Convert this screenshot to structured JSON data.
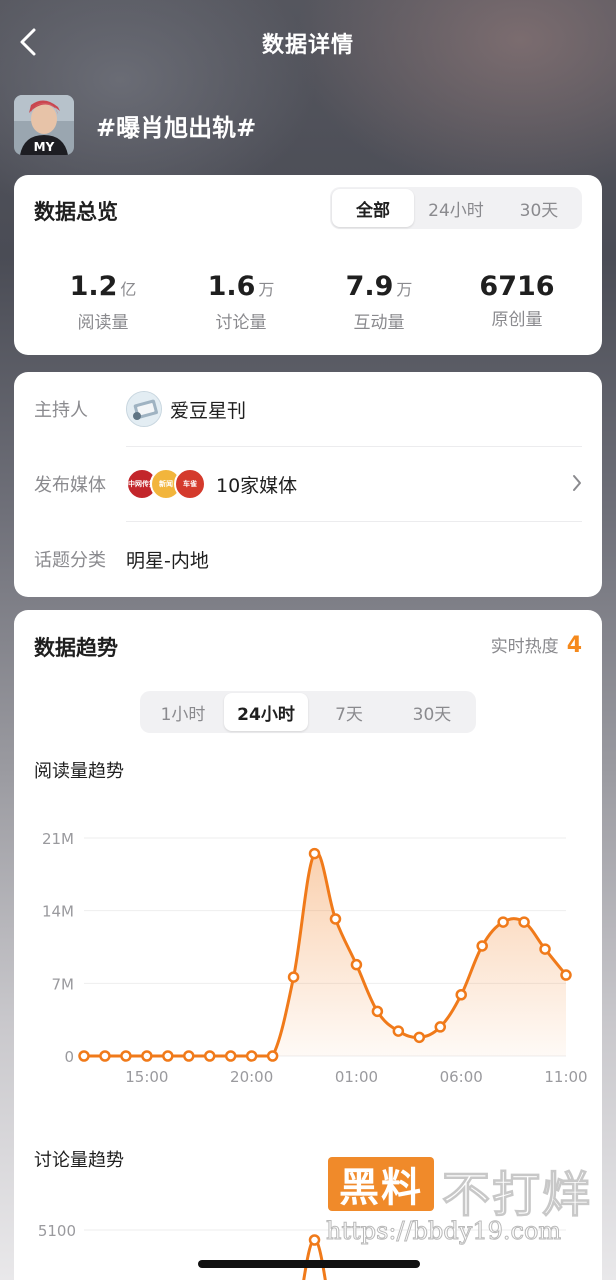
{
  "navbar": {
    "title": "数据详情"
  },
  "topic": {
    "title": "#曝肖旭出轨#",
    "avatar_text": "MY"
  },
  "overview": {
    "title": "数据总览",
    "tabs": [
      "全部",
      "24小时",
      "30天"
    ],
    "active_tab": "全部",
    "stats": [
      {
        "value": "1.2",
        "unit": "亿",
        "label": "阅读量"
      },
      {
        "value": "1.6",
        "unit": "万",
        "label": "讨论量"
      },
      {
        "value": "7.9",
        "unit": "万",
        "label": "互动量"
      },
      {
        "value": "6716",
        "unit": "",
        "label": "原创量"
      }
    ]
  },
  "info": {
    "host": {
      "label": "主持人",
      "value": "爱豆星刊"
    },
    "media": {
      "label": "发布媒体",
      "value": "10家媒体",
      "avatars": [
        "中网传播",
        "新闻",
        "车雀"
      ]
    },
    "category": {
      "label": "话题分类",
      "value": "明星-内地"
    }
  },
  "trend": {
    "title": "数据趋势",
    "heat_label": "实时热度",
    "heat_value": "4",
    "tabs": [
      "1小时",
      "24小时",
      "7天",
      "30天"
    ],
    "active_tab": "24小时",
    "read_chart_title": "阅读量趋势",
    "discuss_chart_title": "讨论量趋势"
  },
  "chart_data": [
    {
      "type": "area",
      "title": "阅读量趋势",
      "yticks": [
        "0",
        "7M",
        "14M",
        "21M"
      ],
      "ylim": [
        0,
        21
      ],
      "xticks": [
        "15:00",
        "20:00",
        "01:00",
        "06:00",
        "11:00"
      ],
      "x": [
        "12:00",
        "13:00",
        "14:00",
        "15:00",
        "16:00",
        "17:00",
        "18:00",
        "19:00",
        "20:00",
        "21:00",
        "22:00",
        "23:00",
        "00:00",
        "01:00",
        "02:00",
        "03:00",
        "04:00",
        "05:00",
        "06:00",
        "07:00",
        "08:00",
        "09:00",
        "10:00",
        "11:00"
      ],
      "series": [
        {
          "values": [
            0,
            0,
            0,
            0,
            0,
            0,
            0,
            0,
            0,
            0,
            7.6,
            19.5,
            13.2,
            8.8,
            4.3,
            2.4,
            1.8,
            2.8,
            5.9,
            10.6,
            12.9,
            12.9,
            10.3,
            7.8
          ]
        }
      ],
      "color": "#f07a1a"
    },
    {
      "type": "area",
      "title": "讨论量趋势",
      "yticks": [
        "5100"
      ],
      "xticks": [],
      "series": [
        {
          "values": [
            5100
          ]
        }
      ],
      "color": "#f07a1a"
    }
  ],
  "watermark": {
    "box": "黑料",
    "text": "不打烊",
    "url": "https://bbdy19.com"
  }
}
